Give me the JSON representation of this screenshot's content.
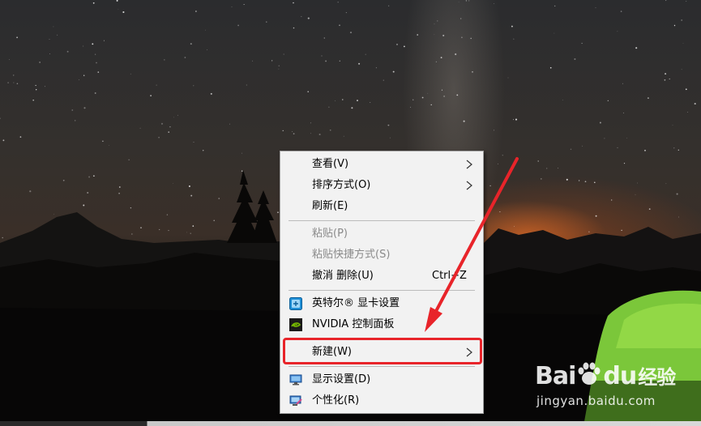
{
  "context_menu": {
    "view": {
      "label": "查看(V)",
      "icon": "chevron-right-icon"
    },
    "sort_by": {
      "label": "排序方式(O)",
      "icon": "chevron-right-icon"
    },
    "refresh": {
      "label": "刷新(E)"
    },
    "paste": {
      "label": "粘贴(P)",
      "disabled": true
    },
    "paste_shortcut": {
      "label": "粘贴快捷方式(S)",
      "disabled": true
    },
    "undo_delete": {
      "label": "撤消 删除(U)",
      "shortcut": "Ctrl+Z"
    },
    "intel_graphics": {
      "label": "英特尔® 显卡设置",
      "icon": "intel-graphics-icon"
    },
    "nvidia_panel": {
      "label": "NVIDIA 控制面板",
      "icon": "nvidia-icon"
    },
    "new": {
      "label": "新建(W)",
      "icon": "chevron-right-icon"
    },
    "display_settings": {
      "label": "显示设置(D)",
      "icon": "display-icon"
    },
    "personalize": {
      "label": "个性化(R)",
      "icon": "personalize-icon"
    }
  },
  "annotation": {
    "highlight_color": "#e8242a",
    "highlighted_item": "新建(W)"
  },
  "watermark": {
    "brand": "Bai",
    "brand_suffix": "du",
    "service": "经验",
    "url": "jingyan.baidu.com"
  }
}
